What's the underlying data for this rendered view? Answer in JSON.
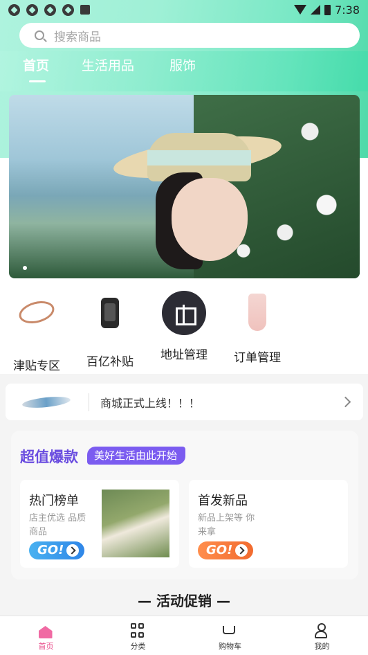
{
  "status_bar": {
    "time": "7:38"
  },
  "search": {
    "placeholder": "搜索商品"
  },
  "tabs": [
    {
      "label": "首页",
      "active": true
    },
    {
      "label": "生活用品",
      "active": false
    },
    {
      "label": "服饰",
      "active": false
    }
  ],
  "categories": [
    {
      "label": "津贴专区",
      "icon": "bracelet-icon"
    },
    {
      "label": "百亿补贴",
      "icon": "smart-band-icon"
    },
    {
      "label": "地址管理",
      "icon": "gift-icon"
    },
    {
      "label": "订单管理",
      "icon": "dress-icon"
    }
  ],
  "notice": {
    "text": "商城正式上线！！！"
  },
  "promo": {
    "title": "超值爆款",
    "tag": "美好生活由此开始",
    "cards": [
      {
        "title": "热门榜单",
        "subtitle": "店主优选 品质商品",
        "go": "GO!"
      },
      {
        "title": "首发新品",
        "subtitle": "新品上架等 你来拿",
        "go": "GO!"
      }
    ]
  },
  "section": {
    "title": "— 活动促销 —"
  },
  "tabbar": [
    {
      "label": "首页",
      "active": true
    },
    {
      "label": "分类",
      "active": false
    },
    {
      "label": "购物车",
      "active": false
    },
    {
      "label": "我的",
      "active": false
    }
  ],
  "colors": {
    "accent": "#e94b8a",
    "promo": "#6a4de0",
    "header": "#9ff0d6"
  }
}
